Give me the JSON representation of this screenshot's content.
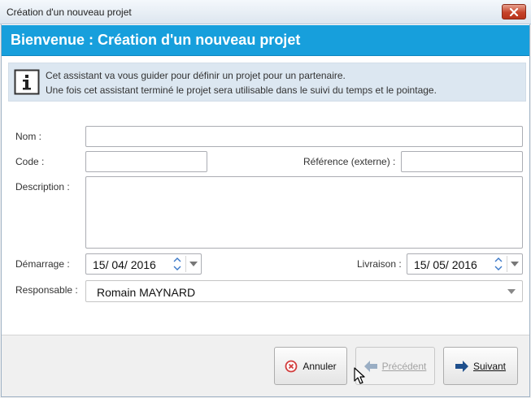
{
  "window": {
    "title": "Création d'un nouveau projet"
  },
  "banner": {
    "heading": "Bienvenue : Création d'un nouveau projet"
  },
  "info": {
    "line1": "Cet assistant va vous guider pour définir un projet pour un partenaire.",
    "line2": "Une fois cet assistant terminé le projet sera utilisable dans le suivi du temps et le pointage."
  },
  "form": {
    "nom_label": "Nom :",
    "nom_value": "",
    "code_label": "Code :",
    "code_value": "",
    "reference_label": "Référence (externe) :",
    "reference_value": "",
    "description_label": "Description :",
    "description_value": "",
    "demarrage_label": "Démarrage :",
    "demarrage_value": "15/ 04/  2016",
    "livraison_label": "Livraison :",
    "livraison_value": "15/ 05/  2016",
    "responsable_label": "Responsable :",
    "responsable_value": "Romain MAYNARD"
  },
  "buttons": {
    "annuler": "Annuler",
    "precedent": "Précédent",
    "suivant": "Suivant"
  },
  "icons": {
    "close": "close-icon",
    "info": "info-icon",
    "cancel": "cancel-circle-icon",
    "back": "arrow-left-icon",
    "next": "arrow-right-icon"
  },
  "colors": {
    "banner": "#179fdc",
    "info_bg": "#dce7f1",
    "close_button": "#c6432a",
    "next_arrow": "#1e4f8c",
    "cancel_icon": "#d23c3c"
  }
}
